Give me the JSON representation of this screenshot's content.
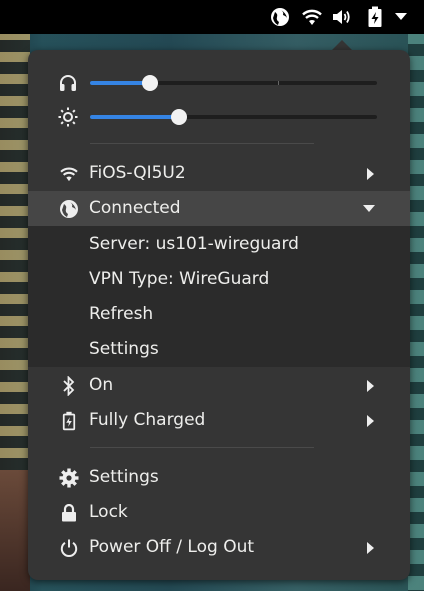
{
  "topbar": {
    "indicators": [
      "vpn-globe-icon",
      "wifi-icon",
      "volume-icon",
      "battery-charging-icon",
      "menu-arrow-down-icon"
    ]
  },
  "sliders": {
    "volume": {
      "icon": "headphones-icon",
      "level": 0.21
    },
    "brightness": {
      "icon": "brightness-icon",
      "level": 0.31
    }
  },
  "network": {
    "wifi_label": "FiOS-QI5U2",
    "vpn_label": "Connected",
    "vpn_items": [
      "Server: us101-wireguard",
      "VPN Type: WireGuard",
      "Refresh",
      "Settings"
    ]
  },
  "bluetooth": {
    "label": "On"
  },
  "power": {
    "label": "Fully Charged"
  },
  "system": {
    "settings_label": "Settings",
    "lock_label": "Lock",
    "power_label": "Power Off / Log Out"
  },
  "colors": {
    "accent": "#3584e4",
    "menu_bg": "#353535",
    "submenu_bg": "#2b2b2b",
    "active_row": "#464646"
  }
}
